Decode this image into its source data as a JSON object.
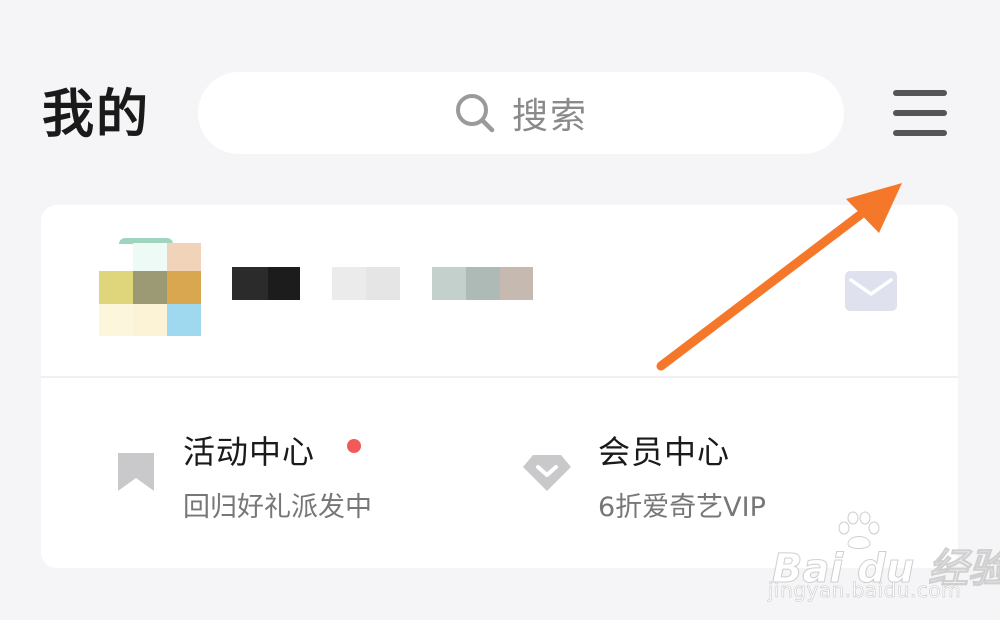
{
  "header": {
    "title": "我的",
    "search_placeholder": "搜索"
  },
  "icons": {
    "search": "search-icon",
    "menu": "hamburger-menu-icon",
    "mail": "mail-icon",
    "activity": "bookmark-icon",
    "vip": "diamond-icon"
  },
  "profile": {
    "avatar": "pixelated-avatar",
    "username_censored": true
  },
  "menu_items": [
    {
      "title": "活动中心",
      "subtitle": "回归好礼派发中",
      "has_badge": true
    },
    {
      "title": "会员中心",
      "subtitle": "6折爱奇艺VIP",
      "has_badge": false
    }
  ],
  "annotation": {
    "type": "arrow",
    "color": "#f5782a",
    "points_to": "hamburger-menu-icon"
  },
  "watermark": {
    "brand": "Bai du 经验",
    "url": "jingyan.baidu.com"
  },
  "colors": {
    "background": "#f5f5f7",
    "card": "#ffffff",
    "badge": "#f25a5a",
    "arrow": "#f5782a"
  }
}
